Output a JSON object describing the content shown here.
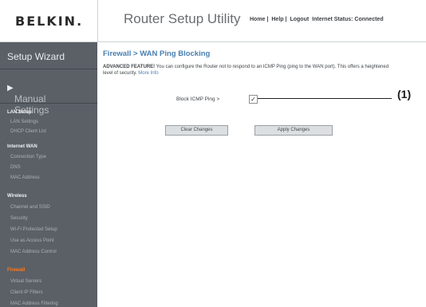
{
  "header": {
    "logo": "BELKIN.",
    "app_title": "Router Setup Utility",
    "nav": [
      "Home",
      "Help",
      "Logout"
    ],
    "status": "Internet Status: Connected"
  },
  "sidebar": {
    "setup_wizard": "Setup Wizard",
    "manual_settings": "Manual Settings",
    "sections": [
      {
        "title": "LAN Setup",
        "items": [
          "LAN Settings",
          "DHCP Client List"
        ]
      },
      {
        "title": "Internet WAN",
        "items": [
          "Connection Type",
          "DNS",
          "MAC Address"
        ]
      },
      {
        "title": "Wireless",
        "items": [
          "Channel and SSID",
          "Security",
          "Wi-Fi Protected Setup",
          "Use as Access Point",
          "MAC Address Control"
        ]
      },
      {
        "title": "Firewall",
        "items": [
          "Virtual Servers",
          "Client IP Filters",
          "MAC Address Filtering"
        ]
      }
    ]
  },
  "main": {
    "title": "Firewall > WAN Ping Blocking",
    "desc_bold": "ADVANCED FEATURE!",
    "desc_text": " You can configure the Router not to respond to an ICMP Ping (ping to the WAN port). This offers a heightened level of security.",
    "more_info": "More Info",
    "block_label": "Block ICMP Ping >",
    "block_checked": "✓",
    "clear_button": "Clear Changes",
    "apply_button": "Apply Changes"
  },
  "callout": {
    "label": "(1)"
  },
  "colors": {
    "sidebar": "#5b6067",
    "accent": "#ff7a1a",
    "title_blue": "#4a7fb0"
  }
}
